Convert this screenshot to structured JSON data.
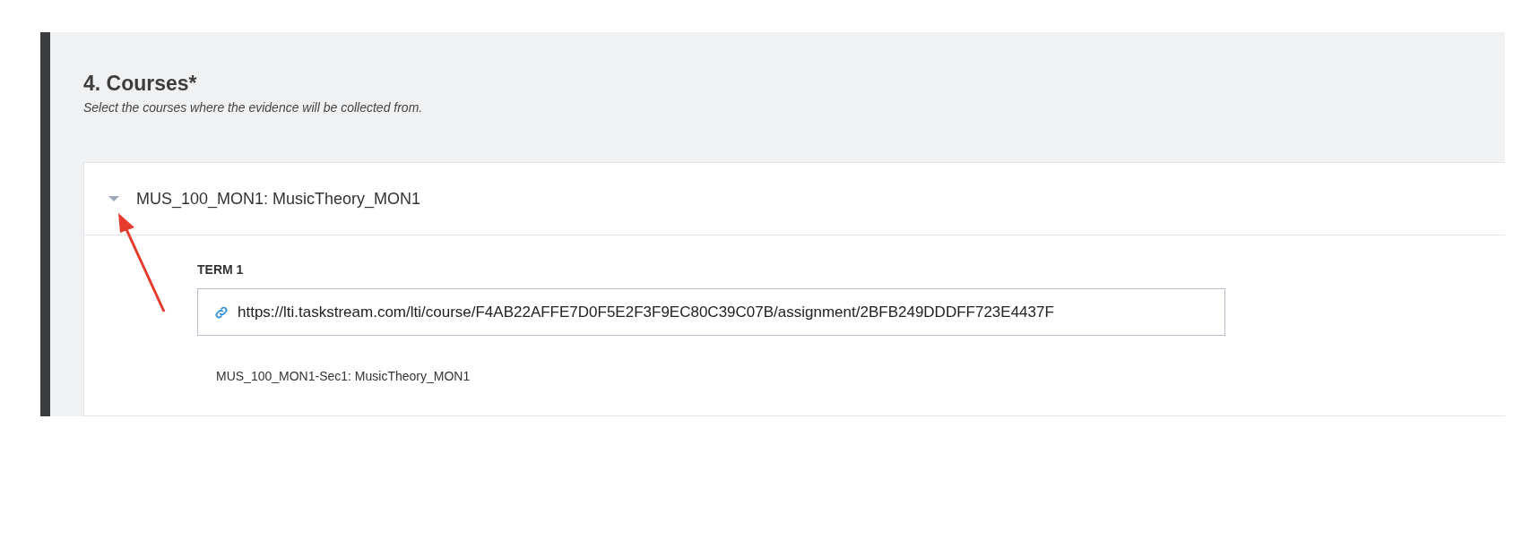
{
  "section": {
    "title": "4. Courses*",
    "subtitle": "Select the courses where the evidence will be collected from."
  },
  "courses": [
    {
      "name": "MUS_100_MON1: MusicTheory_MON1",
      "expanded": true,
      "terms": [
        {
          "label": "TERM 1",
          "link": "https://lti.taskstream.com/lti/course/F4AB22AFFE7D0F5E2F3F9EC80C39C07B/assignment/2BFB249DDDFF723E4437F",
          "sections": [
            "MUS_100_MON1-Sec1: MusicTheory_MON1"
          ]
        }
      ]
    }
  ]
}
